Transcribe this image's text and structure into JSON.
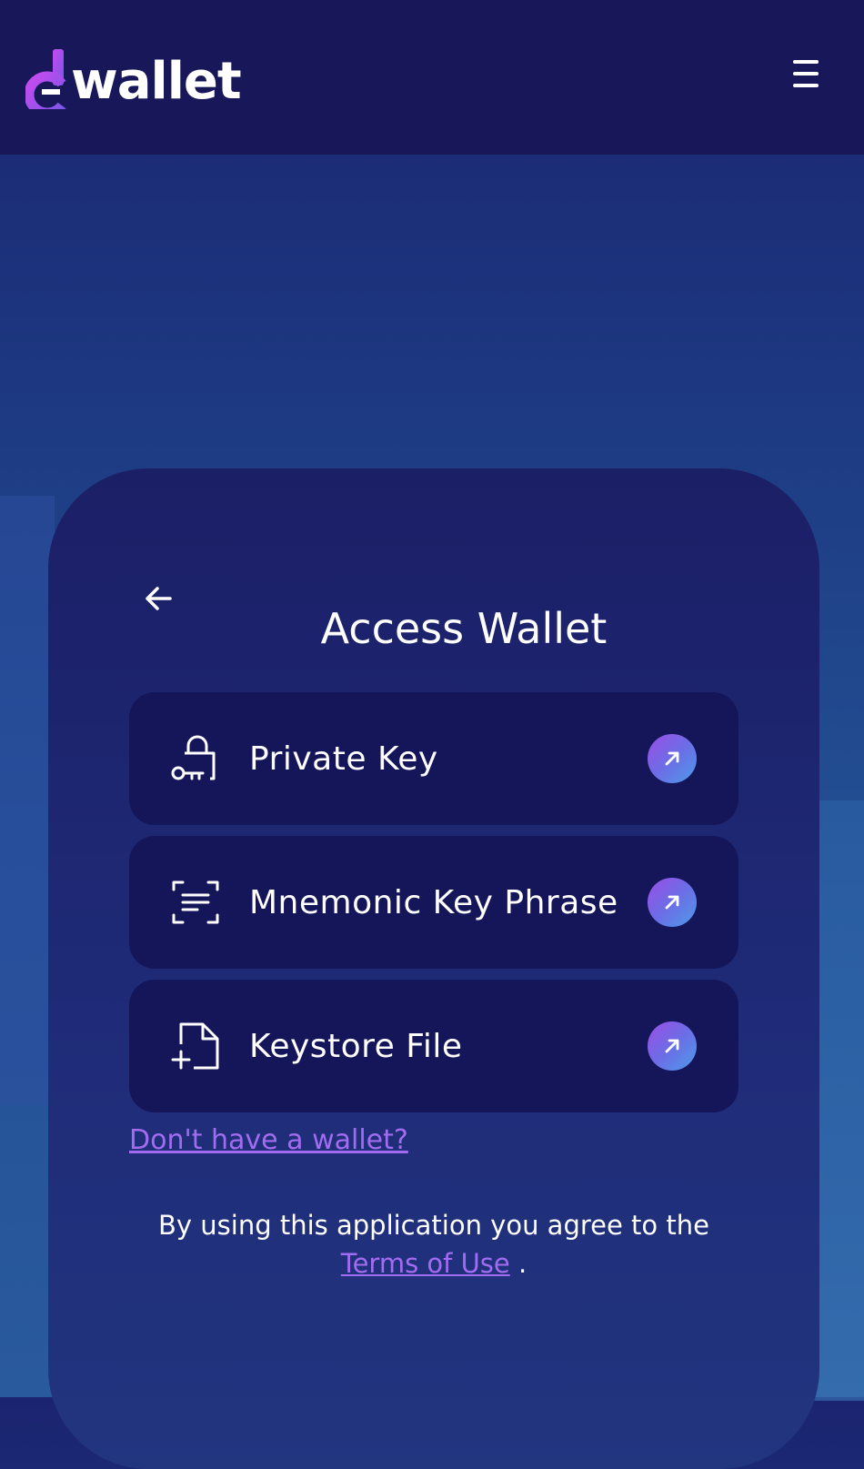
{
  "header": {
    "brand_text": "wallet",
    "menu_icon": "hamburger-menu-icon",
    "background": "#17175a"
  },
  "card": {
    "title": "Access Wallet",
    "back_icon": "arrow-left-icon",
    "options": [
      {
        "label": "Private Key",
        "icon": "key-lock-icon",
        "action_icon": "arrow-up-right-icon"
      },
      {
        "label": "Mnemonic Key Phrase",
        "icon": "scan-text-icon",
        "action_icon": "arrow-up-right-icon"
      },
      {
        "label": "Keystore File",
        "icon": "file-add-icon",
        "action_icon": "arrow-up-right-icon"
      }
    ],
    "no_wallet_link": "Don't have a wallet?",
    "terms_prefix": "By using this application you agree to the",
    "terms_link": "Terms of Use",
    "terms_suffix": "."
  },
  "colors": {
    "accent": "#a26cf0",
    "option_bg": "#15165a",
    "arrow_gradient_start": "#9b4ee6",
    "arrow_gradient_end": "#4d9be8"
  }
}
